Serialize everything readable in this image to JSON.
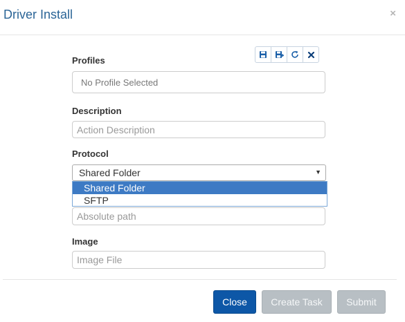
{
  "dialog": {
    "title": "Driver Install",
    "close_glyph": "×"
  },
  "profiles": {
    "label": "Profiles",
    "placeholder": "No Profile Selected"
  },
  "toolbar": {
    "icons": [
      "save-icon",
      "save-as-icon",
      "refresh-icon",
      "clear-icon"
    ]
  },
  "description": {
    "label": "Description",
    "placeholder": "Action Description"
  },
  "protocol": {
    "label": "Protocol",
    "selected": "Shared Folder",
    "options": [
      "Shared Folder",
      "SFTP"
    ]
  },
  "path": {
    "placeholder": "Absolute path"
  },
  "image": {
    "label": "Image",
    "placeholder": "Image File"
  },
  "buttons": {
    "close": "Close",
    "create_task": "Create Task",
    "submit": "Submit"
  },
  "colors": {
    "title": "#2a6496",
    "primary": "#0d57a7",
    "disabled": "#b8bfc4",
    "dropdown_selected": "#3d7ac4",
    "icon": "#1a5fa8"
  }
}
